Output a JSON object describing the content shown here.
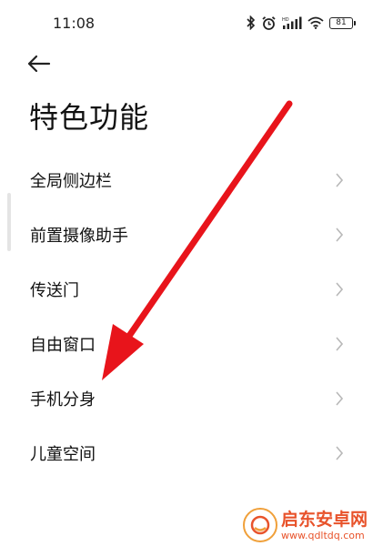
{
  "status_bar": {
    "time": "11:08",
    "battery": "81",
    "icons": [
      "bluetooth-icon",
      "alarm-icon",
      "hd-signal-icon",
      "wifi-icon",
      "battery-icon"
    ]
  },
  "header": {
    "back_icon": "back-arrow-icon",
    "title": "特色功能"
  },
  "menu": {
    "items": [
      {
        "label": "全局侧边栏"
      },
      {
        "label": "前置摄像助手"
      },
      {
        "label": "传送门"
      },
      {
        "label": "自由窗口"
      },
      {
        "label": "手机分身"
      },
      {
        "label": "儿童空间"
      }
    ],
    "chevron_icon": "chevron-right-icon"
  },
  "annotation": {
    "type": "red-arrow",
    "color": "#e8141b"
  },
  "watermark": {
    "title": "启东安卓网",
    "url": "www.qdltdq.com",
    "color": "#e8532b"
  },
  "colors": {
    "background": "#ffffff",
    "text": "#111111",
    "chevron": "#b8b8b8"
  }
}
